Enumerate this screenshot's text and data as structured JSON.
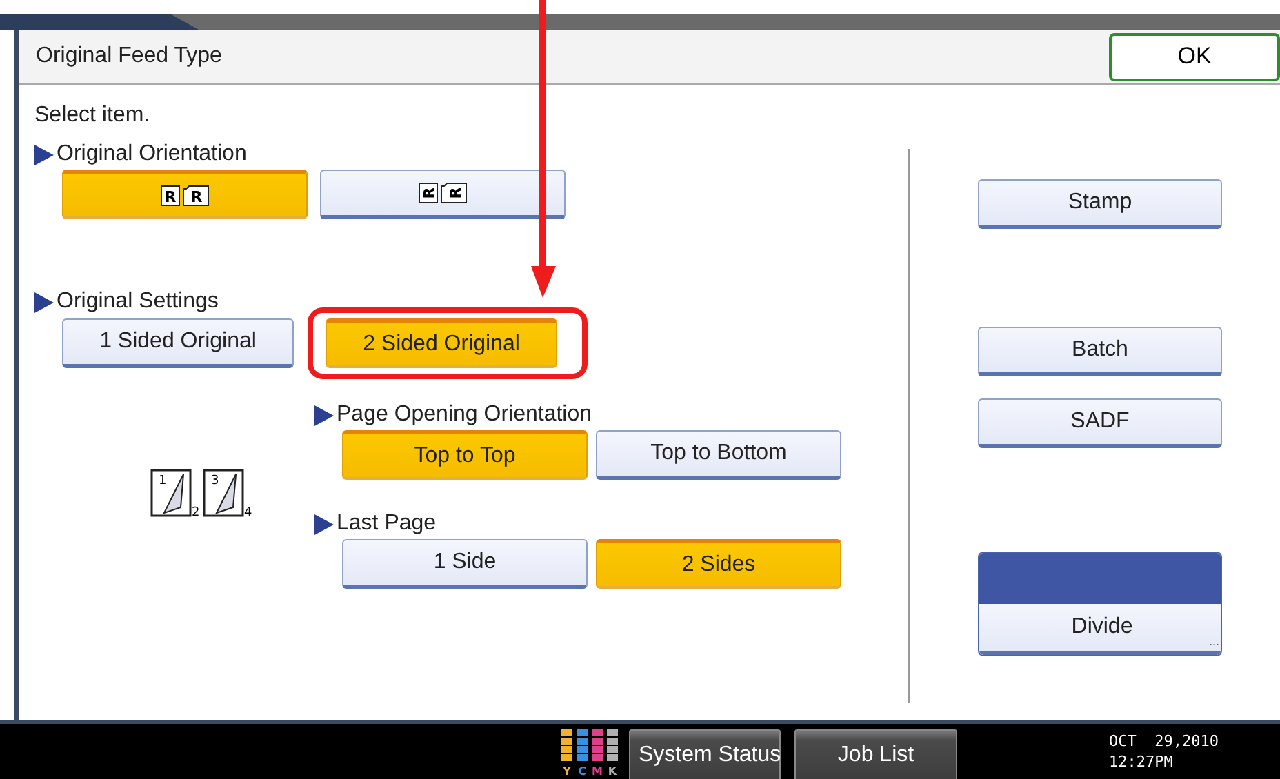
{
  "window": {
    "title": "Original Feed Type"
  },
  "ok_button": "OK",
  "instruction": "Select item.",
  "sections": [
    {
      "label": "Original Orientation",
      "options": [
        {
          "kind": "orientation",
          "glyphs": [
            "R",
            "R"
          ],
          "rotated": false,
          "selected": true
        },
        {
          "kind": "orientation",
          "glyphs": [
            "R",
            "R"
          ],
          "rotated": true,
          "selected": false
        }
      ]
    },
    {
      "label": "Original Settings",
      "options": [
        {
          "kind": "text",
          "label": "1 Sided Original",
          "selected": false,
          "highlighted": false
        },
        {
          "kind": "text",
          "label": "2 Sided Original",
          "selected": true,
          "highlighted": true
        }
      ]
    }
  ],
  "sub_sections": [
    {
      "label": "Page Opening Orientation",
      "options": [
        {
          "label": "Top to Top",
          "selected": true
        },
        {
          "label": "Top to Bottom",
          "selected": false
        }
      ]
    },
    {
      "label": "Last Page",
      "options": [
        {
          "label": "1 Side",
          "selected": false
        },
        {
          "label": "2 Sides",
          "selected": true
        }
      ]
    }
  ],
  "duplex_icon": {
    "pages": [
      [
        "1",
        "2"
      ],
      [
        "3",
        "4"
      ]
    ]
  },
  "annotation_arrow": true,
  "side_buttons": [
    {
      "kind": "button",
      "label": "Stamp"
    },
    {
      "kind": "button",
      "label": "Batch"
    },
    {
      "kind": "button",
      "label": "SADF"
    },
    {
      "kind": "split",
      "label": "Divide",
      "more": "..."
    }
  ],
  "status_bar": {
    "toner": [
      {
        "label": "Y",
        "color": "#f0b030"
      },
      {
        "label": "C",
        "color": "#3a90e0"
      },
      {
        "label": "M",
        "color": "#e0408a"
      },
      {
        "label": "K",
        "color": "#b0b0b0"
      }
    ],
    "buttons": [
      "System Status",
      "Job List"
    ],
    "date": "OCT  29,2010",
    "time": "12:27PM"
  }
}
